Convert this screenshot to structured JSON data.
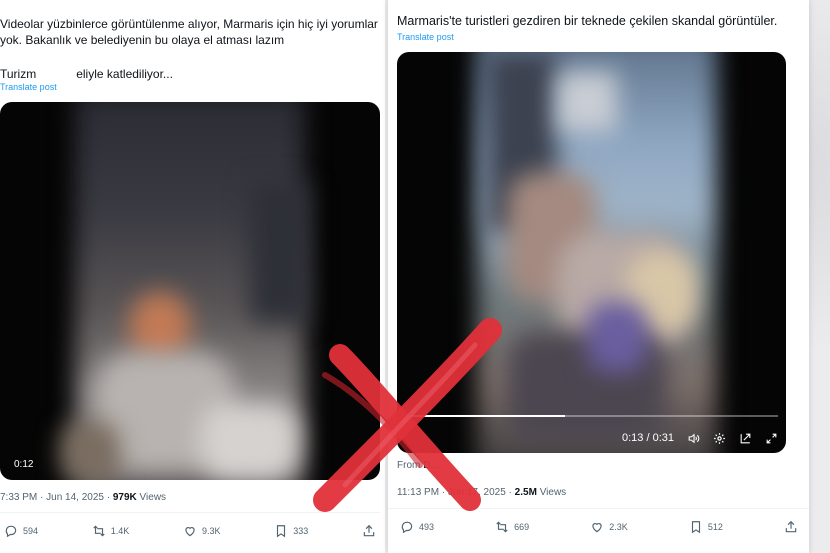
{
  "left_tweet": {
    "text_line1": "Videolar yüzbinlerce görüntülenme alıyor, Marmaris için hiç iyi yorumlar yok. Bakanlık ve belediyenin bu olaya el atması lazım",
    "text_line2_a": "Turizm",
    "text_line2_b": "eliyle katlediliyor...",
    "translate_label": "Translate post",
    "video_time": "0:12",
    "timestamp": "7:33 PM · Jun 14, 2025 ·",
    "views_count": "979K",
    "views_label": "Views",
    "actions": {
      "replies": "594",
      "reposts": "1.4K",
      "likes": "9.3K",
      "bookmarks": "333"
    }
  },
  "right_tweet": {
    "text": "Marmaris'te turistleri gezdiren bir teknede çekilen skandal görüntüler.",
    "translate_label": "Translate post",
    "video_time": "0:13 / 0:31",
    "video_progress": 0.42,
    "from_label": "From",
    "from_source": "D...",
    "timestamp": "11:13 PM · Jun 17, 2025 ·",
    "views_count": "2.5M",
    "views_label": "Views",
    "actions": {
      "replies": "493",
      "reposts": "669",
      "likes": "2.3K",
      "bookmarks": "512"
    }
  },
  "colors": {
    "link_blue": "#1d9bf0",
    "x_mark_red": "#e0303a"
  },
  "icons": [
    "reply-icon",
    "repost-icon",
    "like-icon",
    "bookmark-icon",
    "share-icon",
    "volume-icon",
    "settings-icon",
    "popout-icon",
    "fullscreen-icon"
  ]
}
